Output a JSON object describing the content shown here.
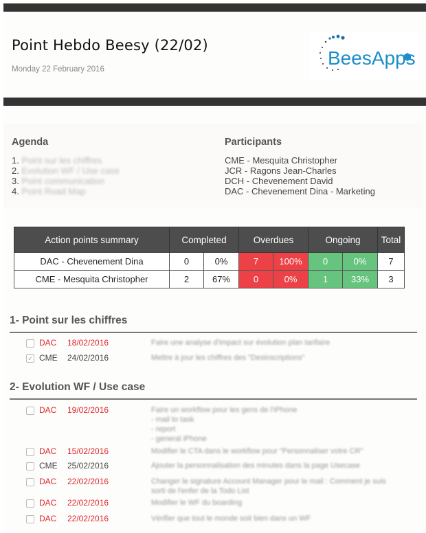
{
  "header": {
    "title": "Point Hebdo Beesy (22/02)",
    "date": "Monday 22 February 2016",
    "logo_text": "BeesApps",
    "brand_color": "#1d8ec9"
  },
  "agenda": {
    "heading": "Agenda",
    "items": [
      {
        "num": "1.",
        "label": "Point sur les chiffres"
      },
      {
        "num": "2.",
        "label": "Evolution WF / Use case"
      },
      {
        "num": "3.",
        "label": "Point communication"
      },
      {
        "num": "4.",
        "label": "Point Road Map"
      }
    ]
  },
  "participants": {
    "heading": "Participants",
    "items": [
      "CME - Mesquita Christopher",
      "JCR - Ragons Jean-Charles",
      "DCH - Chevenement David",
      "DAC - Chevenement Dina - Marketing"
    ]
  },
  "summary": {
    "headers": [
      "Action points summary",
      "Completed",
      "Overdues",
      "Ongoing",
      "Total"
    ],
    "rows": [
      {
        "name": "DAC - Chevenement Dina",
        "completed": "0",
        "completed_pct": "0%",
        "overdue": "7",
        "overdue_pct": "100%",
        "ongoing": "0",
        "ongoing_pct": "0%",
        "total": "7"
      },
      {
        "name": "CME - Mesquita Christopher",
        "completed": "2",
        "completed_pct": "67%",
        "overdue": "0",
        "overdue_pct": "0%",
        "ongoing": "1",
        "ongoing_pct": "33%",
        "total": "3"
      }
    ],
    "colors": {
      "overdue": "#ec4146",
      "ongoing": "#66c47e",
      "header": "#4d4d4d"
    }
  },
  "sections": [
    {
      "title": "1- Point sur les chiffres",
      "items": [
        {
          "checked": false,
          "who": "DAC",
          "due": "18/02/2016",
          "late": true,
          "desc": "Faire une analyse d'impact sur évolution plan tarifaire"
        },
        {
          "checked": true,
          "who": "CME",
          "due": "24/02/2016",
          "late": false,
          "desc": "Mettre à jour les chiffres des \"Desinscriptions\""
        }
      ]
    },
    {
      "title": "2- Evolution WF / Use case",
      "items": [
        {
          "checked": false,
          "who": "DAC",
          "due": "19/02/2016",
          "late": true,
          "desc": "Faire un workflow pour les gens de l'iPhone\n- mail to task\n- report\n- general iPhone"
        },
        {
          "checked": false,
          "who": "DAC",
          "due": "15/02/2016",
          "late": true,
          "desc": "Modifier le CTA dans le workflow pour \"Personnaliser votre CR\""
        },
        {
          "checked": false,
          "who": "CME",
          "due": "25/02/2016",
          "late": false,
          "desc": "Ajouter la personnalisation des minutes dans la page Usecase"
        },
        {
          "checked": false,
          "who": "DAC",
          "due": "22/02/2016",
          "late": true,
          "desc": "Changer le signature Account Manager pour le mail : Comment je suis sorti de l'enfer de la Todo List"
        },
        {
          "checked": false,
          "who": "DAC",
          "due": "22/02/2016",
          "late": true,
          "desc": "Modifier le WF du boarding"
        },
        {
          "checked": false,
          "who": "DAC",
          "due": "22/02/2016",
          "late": true,
          "desc": "Vérifier que tout le monde soit bien dans un WF"
        }
      ]
    }
  ],
  "checkmark_glyph": "✓"
}
